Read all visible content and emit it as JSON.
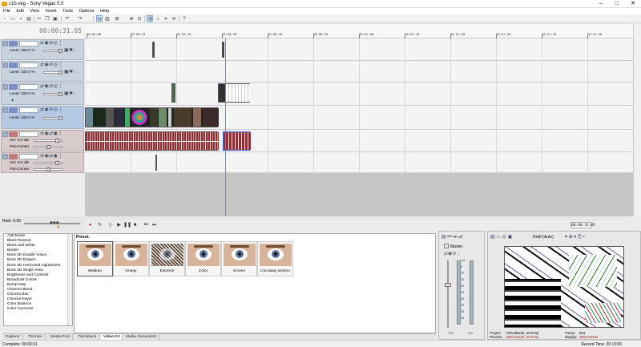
{
  "window": {
    "title": "c1b.veg - Sony Vegas 5.0",
    "minimize": "–",
    "maximize": "□",
    "close": "✕"
  },
  "menu": [
    "File",
    "Edit",
    "View",
    "Insert",
    "Tools",
    "Options",
    "Help"
  ],
  "toolbar_icons": [
    "new-icon",
    "open-icon",
    "save-icon",
    "properties-icon",
    "cut-icon",
    "copy-icon",
    "paste-icon",
    "undo-icon",
    "redo-icon",
    "normal-edit-icon",
    "envelope-icon",
    "selection-icon",
    "zoom-icon",
    "snap-icon",
    "auto-ripple-icon",
    "lock-icon",
    "ignore-grouping-icon",
    "help-icon"
  ],
  "cursor_timecode": "00:00:31.05",
  "ruler_labels": [
    "00:00:00",
    "00:00:10",
    "00:00:20",
    "00:00:30",
    "00:00:40",
    "00:00:50",
    "00:01:00",
    "00:01:10",
    "00:01:20",
    "00:01:30",
    "00:01:40",
    "00:01:50",
    "00:02:00"
  ],
  "tracks": [
    {
      "num": "1",
      "kind": "video",
      "level_label": "Level:",
      "level": "100.0 %"
    },
    {
      "num": "2",
      "kind": "video",
      "level_label": "Level:",
      "level": "100.0 %"
    },
    {
      "num": "3",
      "kind": "video",
      "level_label": "Level:",
      "level": "100.0 %"
    },
    {
      "num": "4",
      "kind": "video",
      "level_label": "Level:",
      "level": "100.0 %"
    },
    {
      "num": "5",
      "kind": "audio",
      "vol_label": "Vol:",
      "vol": "0.0 dB",
      "pan_label": "Pan:",
      "pan": "Center"
    },
    {
      "num": "6",
      "kind": "audio",
      "vol_label": "Vol:",
      "vol": "0.0 dB",
      "pan_label": "Pan:",
      "pan": "Center"
    }
  ],
  "rate": "Rate: 0.00",
  "transport_timecode": "00:00:31.05",
  "fx_list": [
    "Add Noise",
    "Black Restore",
    "Black and White",
    "Border",
    "Boris 3D Double Vision",
    "Boris 3D Drapes",
    "Boris 3D Horizontal Adjustment",
    "Boris 3D Single View",
    "Brightness and Contrast",
    "Broadcast Colors",
    "Bump Map",
    "Channel Blend",
    "Chroma Blur",
    "Chroma Keyer",
    "Color Balance",
    "Color Corrector"
  ],
  "presets_header": "Preset:",
  "presets": [
    "Medium",
    "Grainy",
    "Extreme",
    "Color",
    "Screen",
    "Cut away section"
  ],
  "tabs": [
    "Explorer",
    "Trimmer",
    "Media Pool",
    "Transitions",
    "Video FX",
    "Media Generators"
  ],
  "active_tab": "Video FX",
  "mixer": {
    "label": "Master",
    "scale": [
      "-Inf",
      "6",
      "12",
      "18",
      "24",
      "30",
      "36",
      "42",
      "48",
      "54"
    ],
    "bottom_left": "0.0",
    "bottom_right": "0.0"
  },
  "preview": {
    "quality": "Draft (Auto)",
    "project_label": "Project:",
    "project": "720x480x32, 29.970p",
    "preview_label": "Preview:",
    "preview_val": "180x120x32, 29.970p",
    "frame_label": "Frame:",
    "frame": "934",
    "display_label": "Display:",
    "display": "360x240x32"
  },
  "status": {
    "left": "Complete: 00:00:01",
    "right": "Record Time: 20:13:00"
  },
  "colors": {
    "video_track": "#7d8fc2",
    "audio_track": "#c07a7a",
    "audio_clip": "#8b2f35",
    "selected_clip": "#3a6fd8"
  }
}
